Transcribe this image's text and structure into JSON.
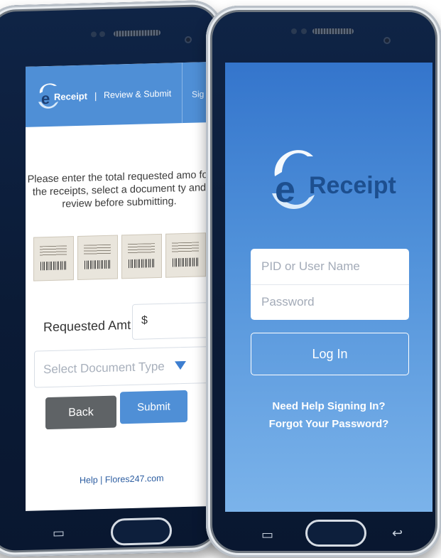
{
  "left_phone": {
    "header": {
      "brand": "Receipt",
      "separator": "|",
      "title": "Review & Submit",
      "truncated_menu": "Sig"
    },
    "instructions": "Please enter the total requested amo for the receipts, select a document ty and review before submitting.",
    "requested_label": "Requested Amt",
    "currency_symbol": "$",
    "document_type_placeholder": "Select Document Type",
    "back_label": "Back",
    "submit_label": "Submit",
    "footer": "Help  |  Flores247.com"
  },
  "right_phone": {
    "brand": "Receipt",
    "username_placeholder": "PID or User Name",
    "password_placeholder": "Password",
    "login_label": "Log In",
    "help_signing_in": "Need Help Signing In?",
    "forgot_password": "Forgot Your Password?"
  },
  "colors": {
    "accent": "#4f8fd6",
    "login_gradient_top": "#3475cc",
    "login_gradient_bottom": "#7bb3ea",
    "back_button": "#5f6366",
    "phone_body": "#0f2446"
  }
}
